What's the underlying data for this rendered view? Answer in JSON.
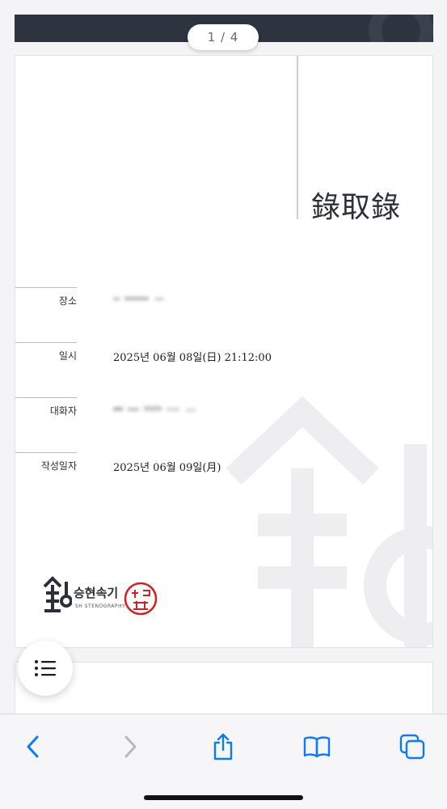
{
  "viewer": {
    "page_indicator": "1 / 4"
  },
  "document": {
    "title": "錄取錄",
    "fields": [
      {
        "label": "장소",
        "value": ""
      },
      {
        "label": "일시",
        "value": "2025년 06월 08일(日) 21:12:00"
      },
      {
        "label": "대화자",
        "value": ""
      },
      {
        "label": "작성일자",
        "value": "2025년 06월 09일(月)"
      }
    ],
    "logo": {
      "brand": "승현속기",
      "subtitle": "SH STENOGRAPHY",
      "seal_text": "속기인"
    }
  },
  "toolbar": {
    "back_icon": "chevron-left-icon",
    "forward_icon": "chevron-right-icon",
    "share_icon": "share-icon",
    "bookmarks_icon": "book-icon",
    "tabs_icon": "tabs-icon"
  },
  "colors": {
    "accent": "#0a7aff",
    "disabled": "#b8b8bd",
    "seal": "#d42020",
    "header_dark": "#2d3440"
  }
}
